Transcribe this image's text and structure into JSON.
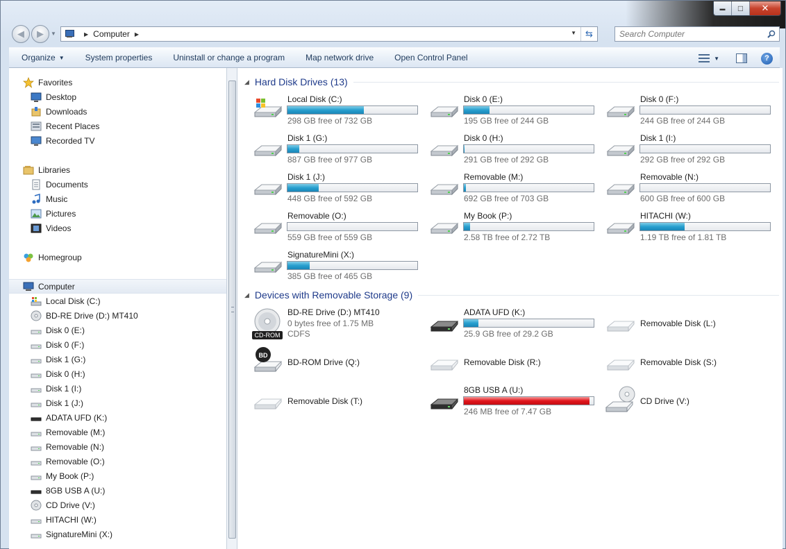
{
  "window": {
    "controls": {
      "minimize": "▬",
      "maximize": "□",
      "close": "✕"
    }
  },
  "address": {
    "path": [
      "Computer"
    ],
    "search_placeholder": "Search Computer"
  },
  "toolbar": {
    "organize": "Organize",
    "system_properties": "System properties",
    "uninstall": "Uninstall or change a program",
    "map_drive": "Map network drive",
    "control_panel": "Open Control Panel",
    "help": "?"
  },
  "nav": {
    "favorites": {
      "label": "Favorites",
      "items": [
        "Desktop",
        "Downloads",
        "Recent Places",
        "Recorded TV"
      ]
    },
    "libraries": {
      "label": "Libraries",
      "items": [
        "Documents",
        "Music",
        "Pictures",
        "Videos"
      ]
    },
    "homegroup": "Homegroup",
    "computer": {
      "label": "Computer",
      "items": [
        {
          "label": "Local Disk (C:)",
          "icon": "windows-drive-icon"
        },
        {
          "label": "BD-RE Drive (D:) MT410",
          "icon": "disc-drive-icon"
        },
        {
          "label": "Disk 0 (E:)",
          "icon": "hard-drive-icon"
        },
        {
          "label": "Disk 0 (F:)",
          "icon": "hard-drive-icon"
        },
        {
          "label": "Disk 1 (G:)",
          "icon": "hard-drive-icon"
        },
        {
          "label": "Disk 0 (H:)",
          "icon": "hard-drive-icon"
        },
        {
          "label": "Disk 1 (I:)",
          "icon": "hard-drive-icon"
        },
        {
          "label": "Disk 1 (J:)",
          "icon": "hard-drive-icon"
        },
        {
          "label": "ADATA UFD (K:)",
          "icon": "usb-drive-icon"
        },
        {
          "label": "Removable (M:)",
          "icon": "hard-drive-icon"
        },
        {
          "label": "Removable (N:)",
          "icon": "hard-drive-icon"
        },
        {
          "label": "Removable (O:)",
          "icon": "hard-drive-icon"
        },
        {
          "label": "My Book (P:)",
          "icon": "hard-drive-icon"
        },
        {
          "label": "8GB USB A (U:)",
          "icon": "usb-drive-icon"
        },
        {
          "label": "CD Drive (V:)",
          "icon": "disc-drive-icon"
        },
        {
          "label": "HITACHI (W:)",
          "icon": "hard-drive-icon"
        },
        {
          "label": "SignatureMini (X:)",
          "icon": "hard-drive-icon"
        }
      ]
    }
  },
  "groups": {
    "hdd": {
      "title": "Hard Disk Drives (13)",
      "drives": [
        {
          "name": "Local Disk (C:)",
          "free": "298 GB free of 732 GB",
          "used_fraction": 0.59,
          "icon": "windows-drive-icon"
        },
        {
          "name": "Disk 0 (E:)",
          "free": "195 GB free of 244 GB",
          "used_fraction": 0.2,
          "icon": "hard-drive-icon"
        },
        {
          "name": "Disk 0 (F:)",
          "free": "244 GB free of 244 GB",
          "used_fraction": 0.0,
          "icon": "hard-drive-icon"
        },
        {
          "name": "Disk 1 (G:)",
          "free": "887 GB free of 977 GB",
          "used_fraction": 0.09,
          "icon": "hard-drive-icon"
        },
        {
          "name": "Disk 0 (H:)",
          "free": "291 GB free of 292 GB",
          "used_fraction": 0.004,
          "icon": "hard-drive-icon"
        },
        {
          "name": "Disk 1 (I:)",
          "free": "292 GB free of 292 GB",
          "used_fraction": 0.0,
          "icon": "hard-drive-icon"
        },
        {
          "name": "Disk 1 (J:)",
          "free": "448 GB free of 592 GB",
          "used_fraction": 0.24,
          "icon": "hard-drive-icon"
        },
        {
          "name": "Removable (M:)",
          "free": "692 GB free of 703 GB",
          "used_fraction": 0.016,
          "icon": "hard-drive-icon"
        },
        {
          "name": "Removable (N:)",
          "free": "600 GB free of 600 GB",
          "used_fraction": 0.0,
          "icon": "hard-drive-icon"
        },
        {
          "name": "Removable (O:)",
          "free": "559 GB free of 559 GB",
          "used_fraction": 0.0,
          "icon": "hard-drive-icon"
        },
        {
          "name": "My Book (P:)",
          "free": "2.58 TB free of 2.72 TB",
          "used_fraction": 0.05,
          "icon": "hard-drive-icon"
        },
        {
          "name": "HITACHI (W:)",
          "free": "1.19 TB free of 1.81 TB",
          "used_fraction": 0.34,
          "icon": "hard-drive-icon"
        },
        {
          "name": "SignatureMini (X:)",
          "free": "385 GB free of 465 GB",
          "used_fraction": 0.17,
          "icon": "hard-drive-icon"
        }
      ]
    },
    "removable": {
      "title": "Devices with Removable Storage (9)",
      "devices": [
        {
          "name": "BD-RE Drive (D:) MT410",
          "free": "0 bytes free of 1.75 MB",
          "sub": "CDFS",
          "icon": "cd-rom-icon",
          "icon_label": "CD-ROM"
        },
        {
          "name": "ADATA UFD (K:)",
          "free": "25.9 GB free of 29.2 GB",
          "used_fraction": 0.11,
          "icon": "usb-drive-icon"
        },
        {
          "name": "Removable Disk (L:)",
          "icon": "removable-disk-icon"
        },
        {
          "name": "BD-ROM Drive (Q:)",
          "icon": "bd-rom-icon",
          "icon_label": "BD"
        },
        {
          "name": "Removable Disk (R:)",
          "icon": "removable-disk-icon"
        },
        {
          "name": "Removable Disk (S:)",
          "icon": "removable-disk-icon"
        },
        {
          "name": "Removable Disk (T:)",
          "icon": "removable-disk-icon"
        },
        {
          "name": "8GB USB A (U:)",
          "free": "246 MB free of 7.47 GB",
          "used_fraction": 0.97,
          "low": true,
          "icon": "usb-drive-icon"
        },
        {
          "name": "CD Drive (V:)",
          "icon": "cd-drive-icon"
        }
      ]
    }
  }
}
